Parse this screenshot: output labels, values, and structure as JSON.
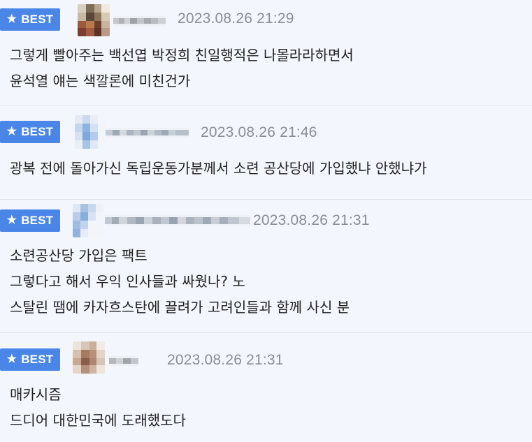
{
  "badge_label": "BEST",
  "comments": [
    {
      "timestamp": "2023.08.26 21:29",
      "lines": [
        "그렇게 빨아주는 백선엽 박정희 친일행적은 나몰라라하면서",
        "윤석열 얘는 색깔론에 미친건가"
      ],
      "avatar": "pixelated-avatar",
      "nickname": "pixelated-nickname"
    },
    {
      "timestamp": "2023.08.26 21:46",
      "lines": [
        "광복 전에 돌아가신 독립운동가분께서 소련 공산당에 가입했냐 안했냐가"
      ],
      "avatar": "pixelated-avatar",
      "nickname": "pixelated-nickname"
    },
    {
      "timestamp": "2023.08.26 21:31",
      "lines": [
        "소련공산당 가입은 팩트",
        "그렇다고 해서 우익 인사들과 싸웠나? 노",
        "스탈린 땜에 카자흐스탄에 끌려가 고려인들과 함께 사신 분"
      ],
      "avatar": "pixelated-avatar",
      "nickname": "pixelated-nickname"
    },
    {
      "timestamp": "2023.08.26 21:31",
      "lines": [
        "매카시즘",
        "드디어 대한민국에 도래했도다"
      ],
      "avatar": "pixelated-avatar",
      "nickname": "pixelated-nickname"
    }
  ],
  "colors": {
    "badge": "#4a86e8",
    "background": "#f3f6fc",
    "timestamp": "#8a8d93",
    "divider": "#dfe3ea"
  }
}
